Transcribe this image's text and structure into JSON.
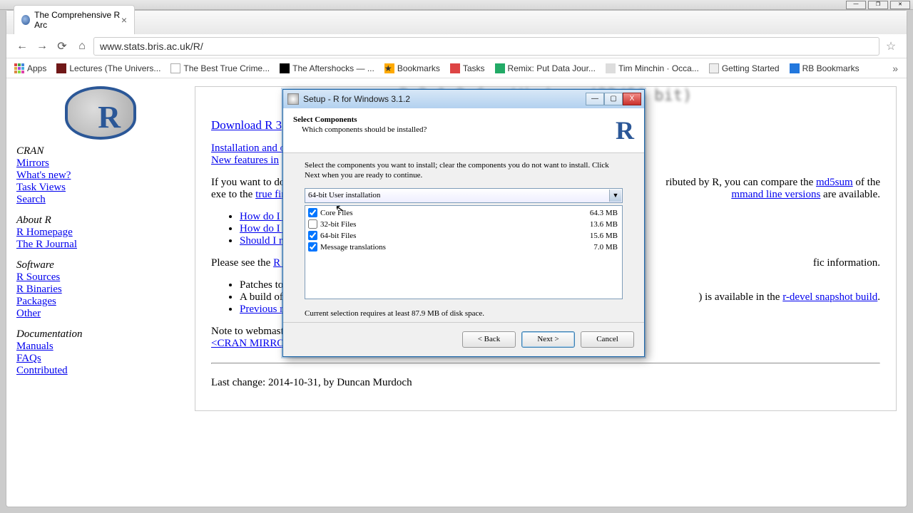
{
  "os_window": {
    "min": "—",
    "restore": "❐",
    "close": "✕"
  },
  "browser": {
    "tab_title": "The Comprehensive R Arc",
    "tab_close": "×",
    "url": "www.stats.bris.ac.uk/R/",
    "nav": {
      "back": "←",
      "forward": "→",
      "reload": "⟳",
      "home": "⌂",
      "star": "☆"
    },
    "apps_label": "Apps",
    "bookmarks": [
      "Lectures (The Univers...",
      "The Best True Crime...",
      "The Aftershocks — ...",
      "Bookmarks",
      "Tasks",
      "Remix: Put Data Jour...",
      "Tim Minchin · Occa...",
      "Getting Started",
      "RB Bookmarks"
    ],
    "overflow": "»"
  },
  "page": {
    "heading": "R-3.1.2 for Windows (32/64 bit)",
    "dl_link": "Download R 3",
    "inst_link": "Installation and o",
    "new_link": "New features in",
    "para1_a": "If you want to doubl",
    "para1_b": "exe to the   ",
    "para1_link1": "true finge",
    "para1_c": "ributed by R, you can compare the ",
    "para1_link2": "md5sum",
    "para1_d": " of the ",
    "para1_link3": "mmand line versions",
    "para1_e": " are available.",
    "li1": "How do I ins",
    "li2": "How do I upd",
    "li3": "Should I run 3",
    "para2_a": "Please see the ",
    "para2_link": "R FA",
    "para2_b": "fic information.",
    "li4": "Patches to th",
    "li5_a": "A build of the",
    "li5_b": ") is available in the ",
    "li5_link": "r-devel snapshot build",
    "prev_rel": "Previous releases",
    "note_a": "Note to webmasters: A stable link which will redirect to the current Windows binary release is",
    "note_link": "<CRAN MIRROR>/bin/windows/base/release.htm",
    "lastchange": "Last change: 2014-10-31, by Duncan Murdoch"
  },
  "sidebar": {
    "g1_title": "CRAN",
    "g1": [
      "Mirrors",
      "What's new?",
      "Task Views",
      "Search"
    ],
    "g2_title": "About R",
    "g2": [
      "R Homepage",
      "The R Journal"
    ],
    "g3_title": "Software",
    "g3": [
      "R Sources",
      "R Binaries",
      "Packages",
      "Other"
    ],
    "g4_title": "Documentation",
    "g4": [
      "Manuals",
      "FAQs",
      "Contributed"
    ]
  },
  "dialog": {
    "title": "Setup - R for Windows 3.1.2",
    "min": "—",
    "max": "▢",
    "close": "X",
    "header": "Select Components",
    "subheader": "Which components should be installed?",
    "logo": "R",
    "instruction": "Select the components you want to install; clear the components you do not want to install. Click Next when you are ready to continue.",
    "dropdown": "64-bit User installation",
    "components": [
      {
        "label": "Core Files",
        "size": "64.3 MB",
        "checked": true
      },
      {
        "label": "32-bit Files",
        "size": "13.6 MB",
        "checked": false
      },
      {
        "label": "64-bit Files",
        "size": "15.6 MB",
        "checked": true
      },
      {
        "label": "Message translations",
        "size": "7.0 MB",
        "checked": true
      }
    ],
    "diskspace": "Current selection requires at least 87.9 MB of disk space.",
    "back": "< Back",
    "next": "Next >",
    "cancel": "Cancel"
  }
}
